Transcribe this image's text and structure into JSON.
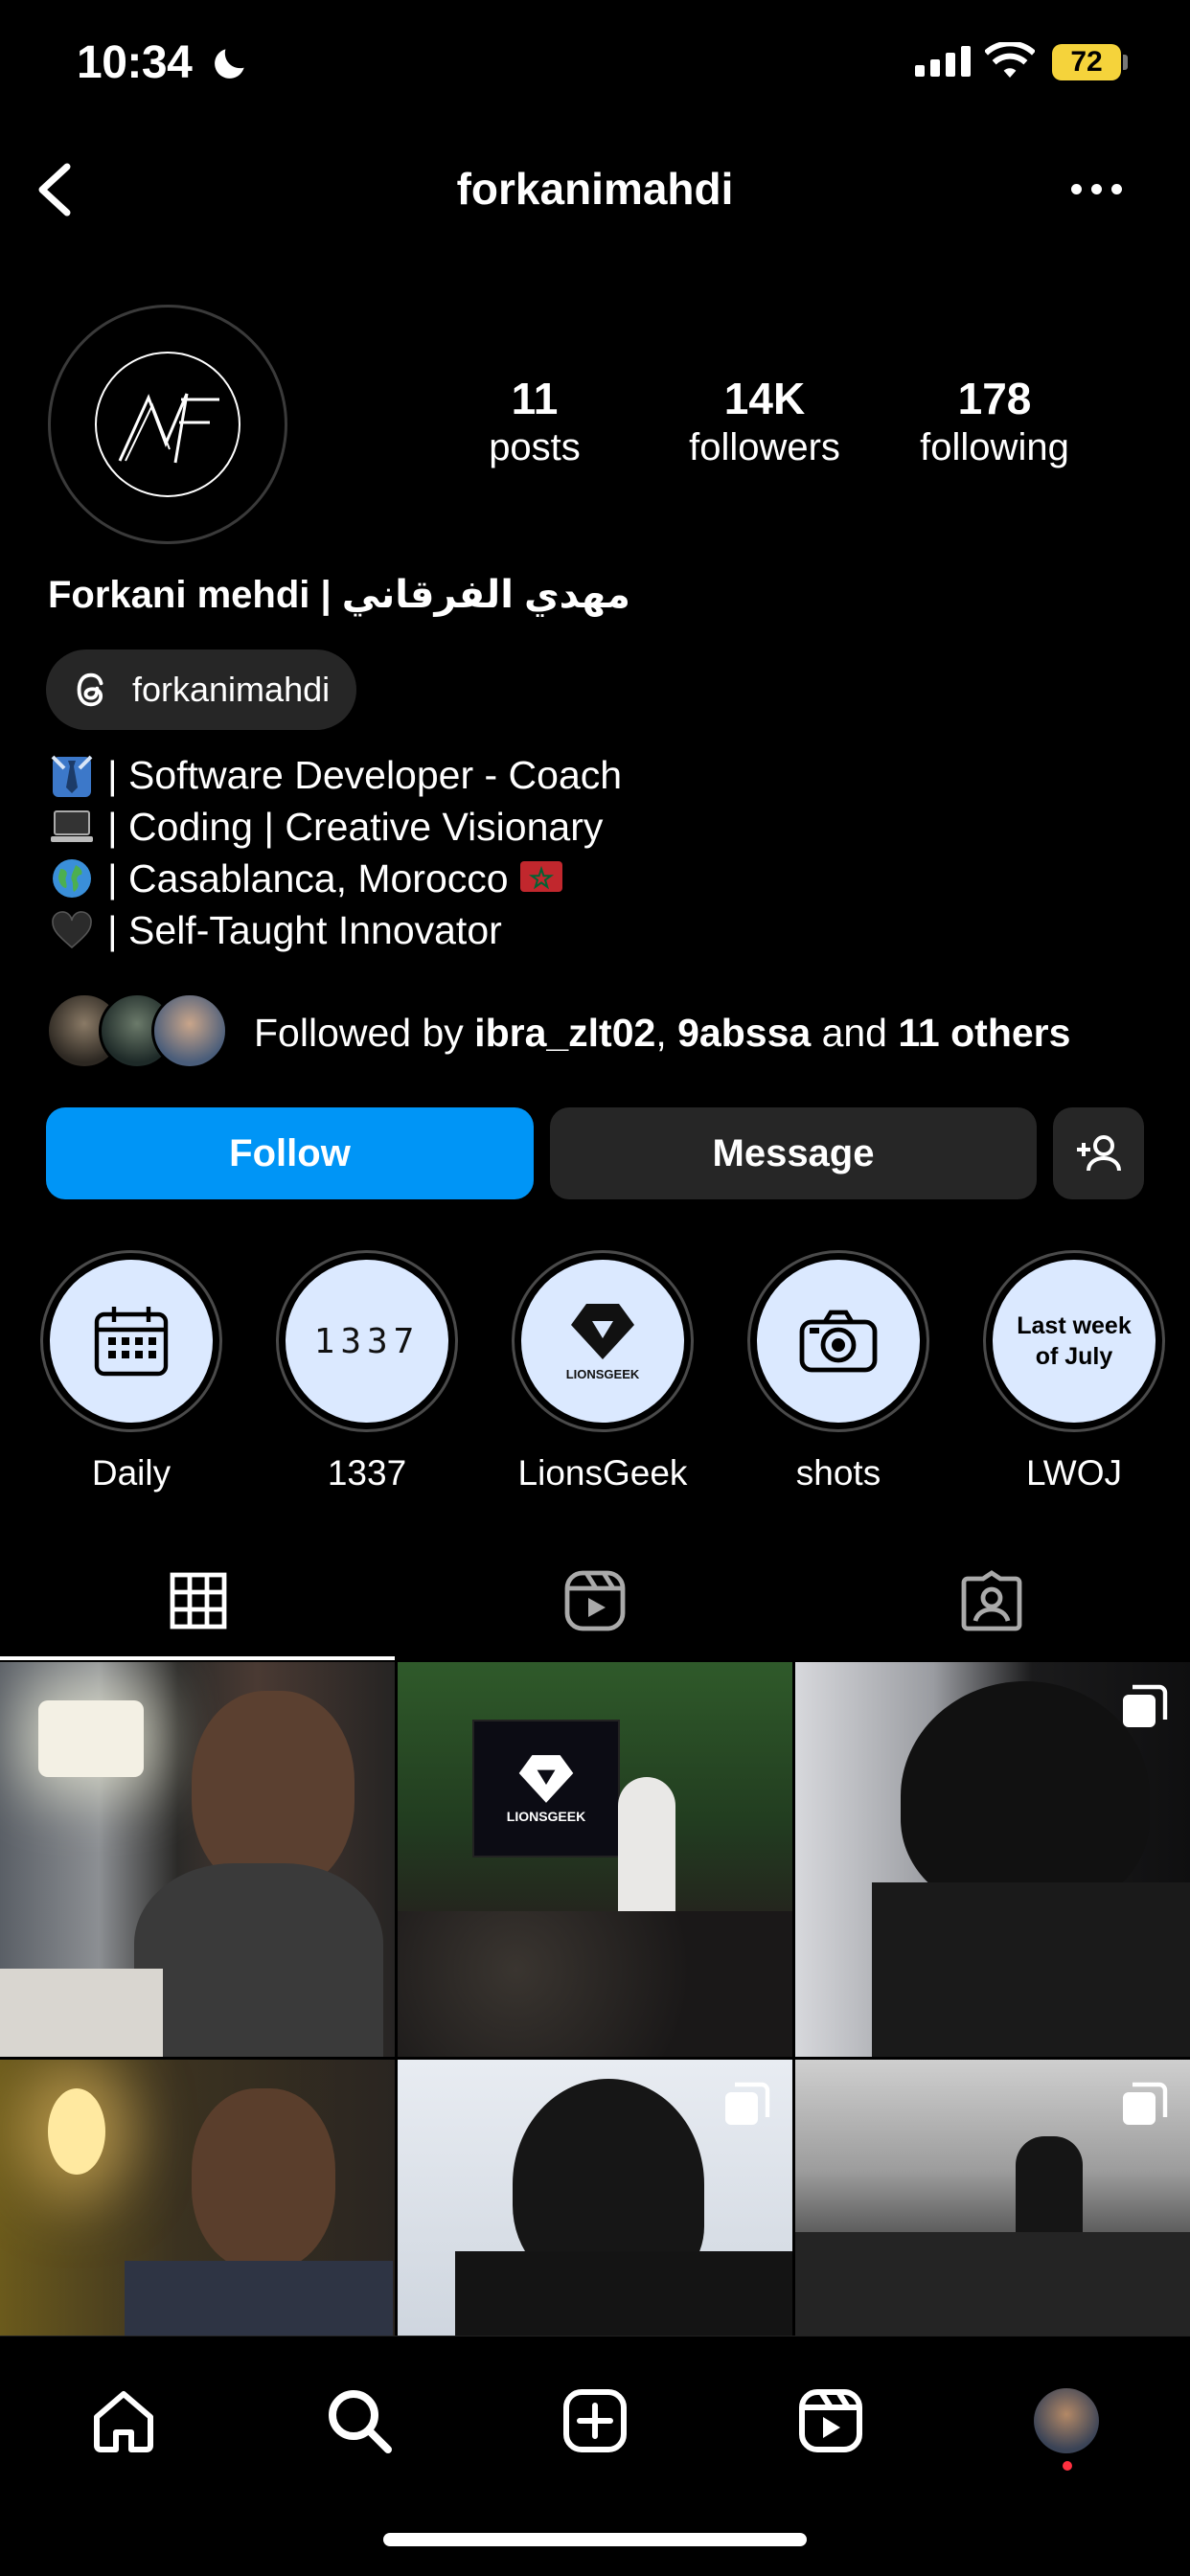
{
  "status_bar": {
    "time": "10:34",
    "battery": "72"
  },
  "header": {
    "title": "forkanimahdi"
  },
  "profile": {
    "stats": [
      {
        "value": "11",
        "label": "posts"
      },
      {
        "value": "14K",
        "label": "followers"
      },
      {
        "value": "178",
        "label": "following"
      }
    ],
    "full_name": "Forkani mehdi | مهدي الفرقاني",
    "threads_handle": "forkanimahdi",
    "bio": [
      {
        "icon": "necktie-icon",
        "text": "| Software Developer - Coach",
        "trail": ""
      },
      {
        "icon": "laptop-icon",
        "text": "| Coding | Creative Visionary",
        "trail": ""
      },
      {
        "icon": "globe-icon",
        "text": "| Casablanca, Morocco",
        "trail": "morocco-flag-icon"
      },
      {
        "icon": "black-heart-icon",
        "text": "| Self-Taught Innovator",
        "trail": ""
      }
    ],
    "followed_by": {
      "prefix": "Followed by ",
      "user1": "ibra_zlt02",
      "sep": ", ",
      "user2": "9abssa",
      "and": " and ",
      "others": "11 others"
    }
  },
  "actions": {
    "follow": "Follow",
    "message": "Message"
  },
  "highlights": [
    {
      "label": "Daily",
      "icon": "calendar-icon"
    },
    {
      "label": "1337",
      "icon_text": "1337"
    },
    {
      "label": "LionsGeek",
      "icon_text": "LIONSGEEK"
    },
    {
      "label": "shots",
      "icon": "camera-icon"
    },
    {
      "label": "LWOJ",
      "icon_text_1": "Last week",
      "icon_text_2": "of July"
    }
  ],
  "tabs": [
    "grid-tab",
    "reels-tab",
    "tagged-tab"
  ],
  "grid_tile_texts": {
    "lionsgeek": "LIONSGEEK"
  },
  "colors": {
    "follow": "#0095f6",
    "button": "#262626",
    "highlight_bg": "#dbe9ff"
  }
}
